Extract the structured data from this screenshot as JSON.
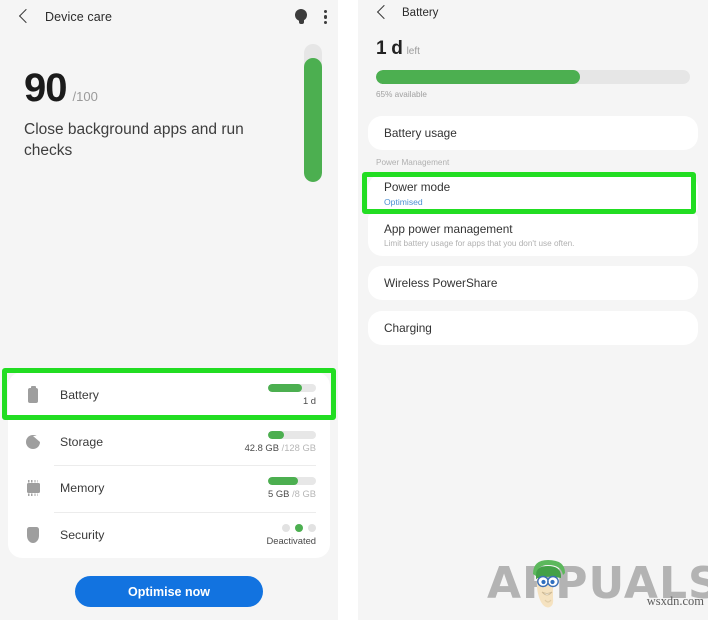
{
  "device_care": {
    "header": {
      "back_icon": "back-chevron-icon",
      "title": "Device care",
      "tips_icon": "lightbulb-icon",
      "more_icon": "kebab-menu-icon"
    },
    "score": {
      "value": "90",
      "max": "/100",
      "message": "Close background apps and run checks",
      "gauge_percent": 90
    },
    "stats": [
      {
        "icon": "battery-icon",
        "label": "Battery",
        "value": "1 d",
        "value_dim": "",
        "bar_percent": 70,
        "indicator": "bar"
      },
      {
        "icon": "storage-pie-icon",
        "label": "Storage",
        "value": "42.8 GB",
        "value_dim": " /128 GB",
        "bar_percent": 34,
        "indicator": "bar"
      },
      {
        "icon": "memory-chip-icon",
        "label": "Memory",
        "value": "5 GB",
        "value_dim": " /8 GB",
        "bar_percent": 63,
        "indicator": "bar"
      },
      {
        "icon": "shield-icon",
        "label": "Security",
        "value": "Deactivated",
        "value_dim": "",
        "bar_percent": 0,
        "indicator": "dots",
        "dots_active": 1
      }
    ],
    "optimise_button": "Optimise now"
  },
  "battery": {
    "header": {
      "back_icon": "back-chevron-icon",
      "title": "Battery"
    },
    "status": {
      "time_left": "1 d",
      "time_left_suffix": "left",
      "bar_percent": 65,
      "available_text": "65% available"
    },
    "battery_usage_label": "Battery usage",
    "power_management_label": "Power Management",
    "power_mode": {
      "title": "Power mode",
      "subtitle": "Optimised"
    },
    "app_power_management": {
      "title": "App power management",
      "subtitle": "Limit battery usage for apps that you don't use often."
    },
    "wireless_powershare_label": "Wireless PowerShare",
    "charging_label": "Charging"
  },
  "watermark": {
    "brand": "APPUALS",
    "site": "wsxdn.com"
  },
  "colors": {
    "accent_green": "#4caf50",
    "highlight_green": "#22dd22",
    "button_blue": "#1273e0",
    "link_blue": "#4d8fd1",
    "panel_bg": "#f5f5f5",
    "card_bg": "#ffffff"
  }
}
